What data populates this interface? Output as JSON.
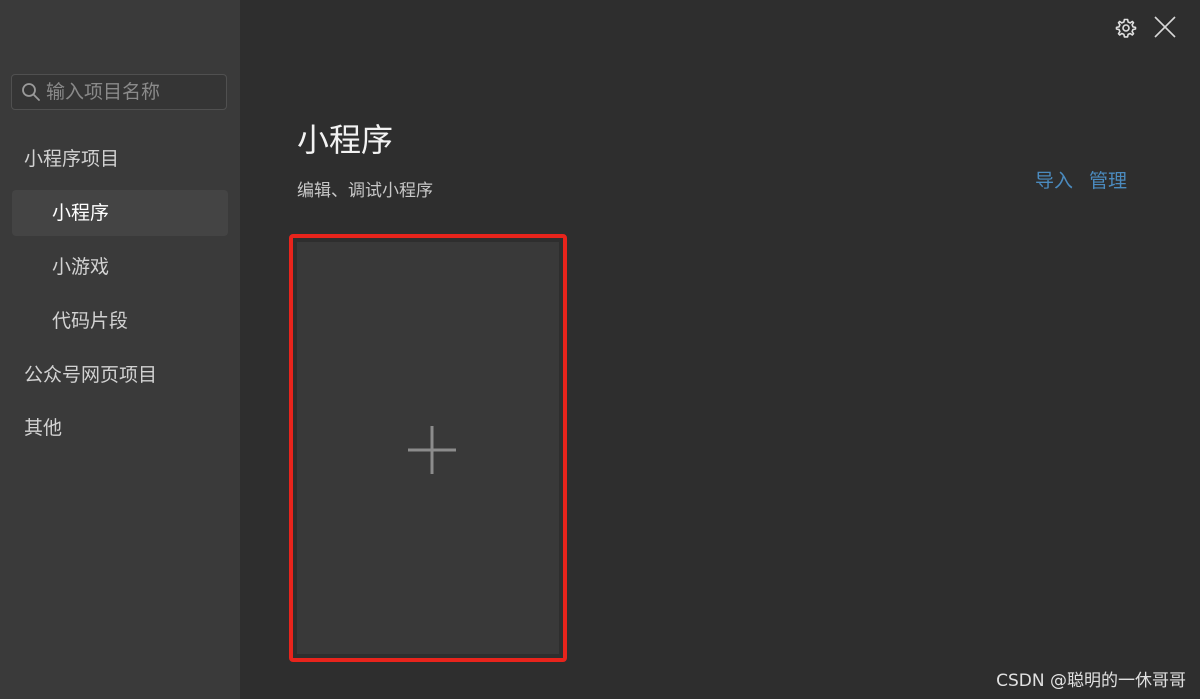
{
  "sidebar": {
    "search_placeholder": "输入项目名称",
    "items": [
      {
        "label": "小程序项目",
        "level": 0,
        "active": false
      },
      {
        "label": "小程序",
        "level": 1,
        "active": true
      },
      {
        "label": "小游戏",
        "level": 1,
        "active": false
      },
      {
        "label": "代码片段",
        "level": 1,
        "active": false
      },
      {
        "label": "公众号网页项目",
        "level": 0,
        "active": false
      },
      {
        "label": "其他",
        "level": 0,
        "active": false
      }
    ]
  },
  "topbar": {
    "icons": [
      "gear-icon",
      "close-icon"
    ]
  },
  "main": {
    "title": "小程序",
    "subtitle": "编辑、调试小程序",
    "actions": {
      "import_label": "导入",
      "manage_label": "管理"
    },
    "new_project_icon": "plus-icon"
  },
  "watermark": "CSDN @聪明的一休哥哥",
  "colors": {
    "sidebar_bg": "#3a3a3a",
    "main_bg": "#2e2e2e",
    "link": "#4b8bbf",
    "highlight_border": "#e8241c"
  }
}
